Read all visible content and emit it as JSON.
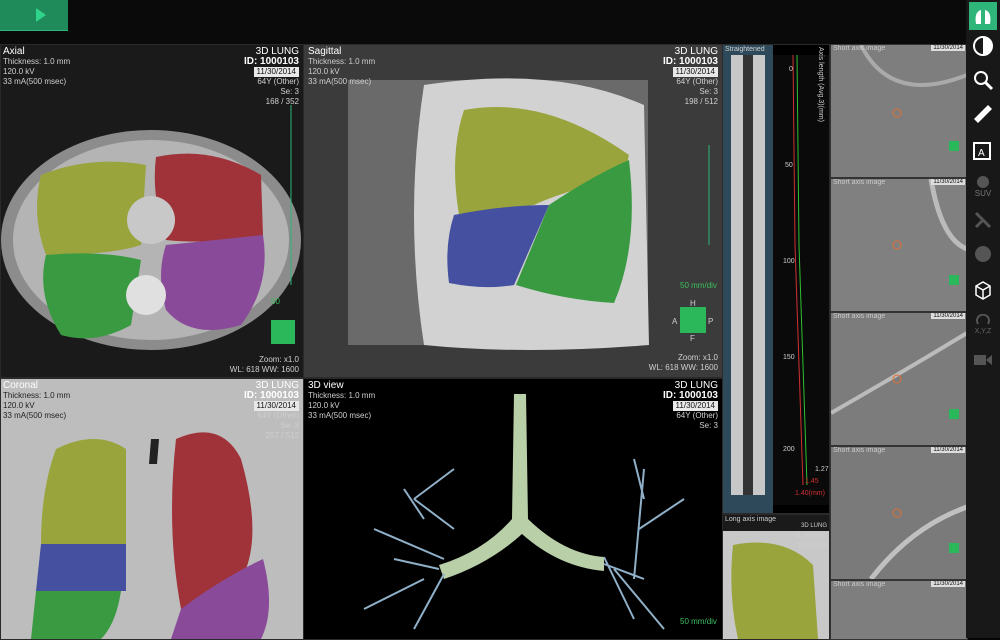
{
  "axial": {
    "title": "Axial",
    "thickness": "Thickness: 1.0 mm",
    "kv": "120.0 kV",
    "ma": "33 mA(500 msec)",
    "study": "3D LUNG",
    "id": "ID: 1000103",
    "date": "11/30/2014",
    "age": "64Y (Other)",
    "se": "Se: 3",
    "slice": "168 / 352",
    "scale": "50",
    "zoom": "Zoom: x1.0",
    "wlww": "WL: 618  WW: 1600"
  },
  "sagittal": {
    "title": "Sagittal",
    "thickness": "Thickness: 1.0 mm",
    "kv": "120.0 kV",
    "ma": "33 mA(500 msec)",
    "study": "3D LUNG",
    "id": "ID: 1000103",
    "date": "11/30/2014",
    "age": "64Y (Other)",
    "se": "Se: 3",
    "slice": "198 / 512",
    "scale": "50",
    "scale_unit": "mm/div",
    "orient": {
      "h": "H",
      "a": "A",
      "p": "P",
      "f": "F"
    },
    "zoom": "Zoom: x1.0",
    "wlww": "WL: 618  WW: 1600"
  },
  "coronal": {
    "title": "Coronal",
    "thickness": "Thickness: 1.0 mm",
    "kv": "120.0 kV",
    "ma": "33 mA(500 msec)",
    "study": "3D LUNG",
    "id": "ID: 1000103",
    "date": "11/30/2014",
    "age": "64Y (Other)",
    "se": "Se: 3",
    "slice": "257 / 512"
  },
  "view3d": {
    "title": "3D view",
    "thickness": "Thickness: 1.0 mm",
    "kv": "120.0 kV",
    "ma": "33 mA(500 msec)",
    "study": "3D LUNG",
    "id": "ID: 1000103",
    "date": "11/30/2014",
    "age": "64Y (Other)",
    "se": "Se: 3",
    "scale": "50",
    "scale_unit": "mm/div"
  },
  "straight": {
    "title": "Straightened",
    "axis_label": "Axis length (Avg.3)(mm)",
    "ticks": [
      "0",
      "50",
      "100",
      "150",
      "200"
    ],
    "values": [
      "1.27",
      "1.45",
      "1.40(mm)"
    ]
  },
  "longaxis": {
    "title": "Long axis image",
    "study": "3D LUNG",
    "id": "ID: 1000103",
    "date": "11/30/2014"
  },
  "shortaxis": {
    "title": "Short axis image",
    "date": "11/30/2014"
  },
  "colors": {
    "upper": "#9aa43c",
    "lower_green": "#3a9a42",
    "blue": "#4550a0",
    "red": "#a0333a",
    "purple": "#8a4a9a",
    "accent": "#2fb579"
  },
  "toolbar": [
    "lung-icon",
    "contrast-icon",
    "zoom-icon",
    "ruler-icon",
    "annotation-icon",
    "suv-icon",
    "tool-icon",
    "blob-icon",
    "cube-icon",
    "rotate-xyz-icon",
    "video-icon"
  ],
  "toolbar_labels": {
    "suv": "SUV",
    "xyz": "X,Y,Z"
  }
}
